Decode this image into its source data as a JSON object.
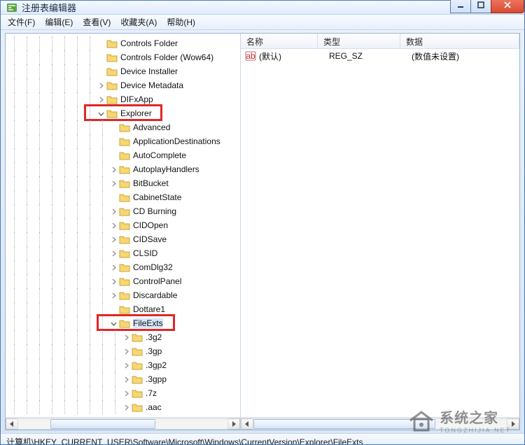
{
  "window": {
    "title": "注册表编辑器"
  },
  "menu": {
    "file": "文件(F)",
    "edit": "编辑(E)",
    "view": "查看(V)",
    "favorites": "收藏夹(A)",
    "help": "帮助(H)"
  },
  "tree": {
    "items": [
      {
        "depth": 7,
        "toggle": "none",
        "label": "Controls Folder"
      },
      {
        "depth": 7,
        "toggle": "none",
        "label": "Controls Folder (Wow64)"
      },
      {
        "depth": 7,
        "toggle": "none",
        "label": "Device Installer"
      },
      {
        "depth": 7,
        "toggle": "closed",
        "label": "Device Metadata"
      },
      {
        "depth": 7,
        "toggle": "closed",
        "label": "DIFxApp"
      },
      {
        "depth": 7,
        "toggle": "open",
        "label": "Explorer",
        "hl": true
      },
      {
        "depth": 8,
        "toggle": "none",
        "label": "Advanced"
      },
      {
        "depth": 8,
        "toggle": "none",
        "label": "ApplicationDestinations"
      },
      {
        "depth": 8,
        "toggle": "none",
        "label": "AutoComplete"
      },
      {
        "depth": 8,
        "toggle": "closed",
        "label": "AutoplayHandlers"
      },
      {
        "depth": 8,
        "toggle": "closed",
        "label": "BitBucket"
      },
      {
        "depth": 8,
        "toggle": "none",
        "label": "CabinetState"
      },
      {
        "depth": 8,
        "toggle": "closed",
        "label": "CD Burning"
      },
      {
        "depth": 8,
        "toggle": "closed",
        "label": "CIDOpen"
      },
      {
        "depth": 8,
        "toggle": "closed",
        "label": "CIDSave"
      },
      {
        "depth": 8,
        "toggle": "closed",
        "label": "CLSID"
      },
      {
        "depth": 8,
        "toggle": "closed",
        "label": "ComDlg32"
      },
      {
        "depth": 8,
        "toggle": "closed",
        "label": "ControlPanel"
      },
      {
        "depth": 8,
        "toggle": "closed",
        "label": "Discardable"
      },
      {
        "depth": 8,
        "toggle": "none",
        "label": "Dottare1"
      },
      {
        "depth": 8,
        "toggle": "open",
        "label": "FileExts",
        "hl": true,
        "selected": true
      },
      {
        "depth": 9,
        "toggle": "closed",
        "label": ".3g2"
      },
      {
        "depth": 9,
        "toggle": "closed",
        "label": ".3gp"
      },
      {
        "depth": 9,
        "toggle": "closed",
        "label": ".3gp2"
      },
      {
        "depth": 9,
        "toggle": "closed",
        "label": ".3gpp"
      },
      {
        "depth": 9,
        "toggle": "closed",
        "label": ".7z"
      },
      {
        "depth": 9,
        "toggle": "closed",
        "label": ".aac"
      }
    ]
  },
  "list": {
    "columns": {
      "name": "名称",
      "type": "类型",
      "data": "数据"
    },
    "rows": [
      {
        "name": "(默认)",
        "type": "REG_SZ",
        "data": "(数值未设置)"
      }
    ]
  },
  "status": {
    "path": "计算机\\HKEY_CURRENT_USER\\Software\\Microsoft\\Windows\\CurrentVersion\\Explorer\\FileExts"
  },
  "watermark": {
    "line1": "系统之家",
    "line2": "TONGZHIJIA.NET"
  }
}
